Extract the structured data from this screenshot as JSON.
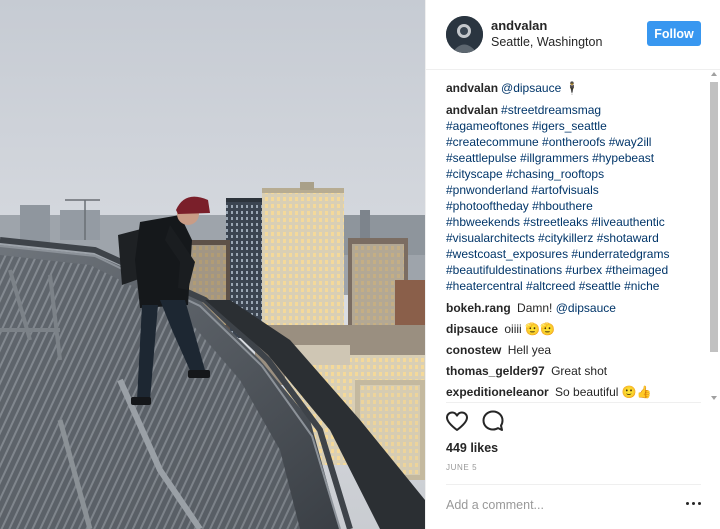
{
  "post": {
    "author": {
      "username": "andvalan",
      "location": "Seattle, Washington",
      "follow_label": "Follow"
    },
    "photo": {
      "icon": "photo-rooftop-seattle"
    },
    "caption": {
      "first_line": {
        "username": "andvalan",
        "mention": "@dipsauce",
        "emoji": "🕴"
      },
      "username": "andvalan",
      "hashtag_lines": [
        "#streetdreamsmag",
        "#agameoftones #igers_seattle",
        "#createcommune #ontheroofs #way2ill",
        "#seattlepulse #illgrammers #hypebeast",
        "#cityscape #chasing_rooftops",
        "#pnwonderland #artofvisuals",
        "#photooftheday #hbouthere",
        "#hbweekends #streetleaks #liveauthentic",
        "#visualarchitects #citykillerz #shotaward",
        "#westcoast_exposures #underratedgrams",
        "#beautifuldestinations #urbex #theimaged",
        "#heatercentral #altcreed #seattle #niche"
      ]
    },
    "comments": [
      {
        "username": "bokeh.rang",
        "text": "Damn!",
        "mention": "@dipsauce"
      },
      {
        "username": "dipsauce",
        "text": "oiiii 🫡🫡",
        "mention": ""
      },
      {
        "username": "conostew",
        "text": "Hell yea",
        "mention": ""
      },
      {
        "username": "thomas_gelder97",
        "text": "Great shot",
        "mention": ""
      },
      {
        "username": "expeditioneleanor",
        "text": "So beautiful 🙂👍",
        "mention": ""
      }
    ],
    "actions": {
      "like_icon": "heart-icon",
      "comment_icon": "comment-icon"
    },
    "likes": "449 likes",
    "date": "JUNE 5",
    "add_comment": {
      "placeholder": "Add a comment...",
      "more_icon": "more-options-icon"
    }
  },
  "colors": {
    "follow_button": "#3897f0",
    "link": "#003569",
    "text": "#262626",
    "muted": "#999999",
    "divider": "#efefef"
  }
}
